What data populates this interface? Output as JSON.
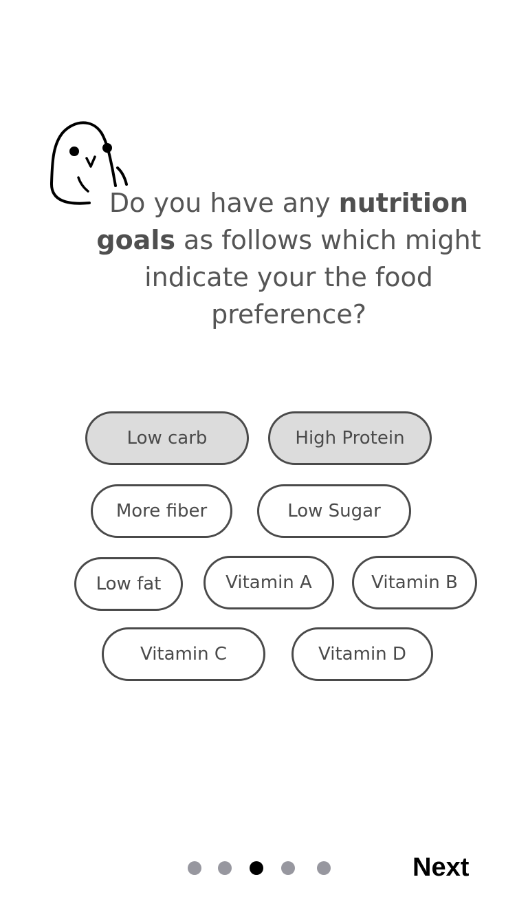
{
  "question": {
    "part1": "Do you have any ",
    "bold1": "nutrition",
    "bold2": "goals",
    "part2": " as follows which might indicate your the food preference?"
  },
  "options": [
    {
      "label": "Low carb",
      "selected": true
    },
    {
      "label": "High Protein",
      "selected": true
    },
    {
      "label": "More fiber",
      "selected": false
    },
    {
      "label": "Low Sugar",
      "selected": false
    },
    {
      "label": "Low fat",
      "selected": false
    },
    {
      "label": "Vitamin A",
      "selected": false
    },
    {
      "label": "Vitamin B",
      "selected": false
    },
    {
      "label": "Vitamin C",
      "selected": false
    },
    {
      "label": "Vitamin D",
      "selected": false
    }
  ],
  "pager": {
    "total": 5,
    "current": 3
  },
  "next_label": "Next",
  "colors": {
    "chip_border": "#4a4a4a",
    "chip_selected_bg": "#dcdcdc",
    "dot_inactive": "#97979f",
    "dot_active": "#000000"
  }
}
